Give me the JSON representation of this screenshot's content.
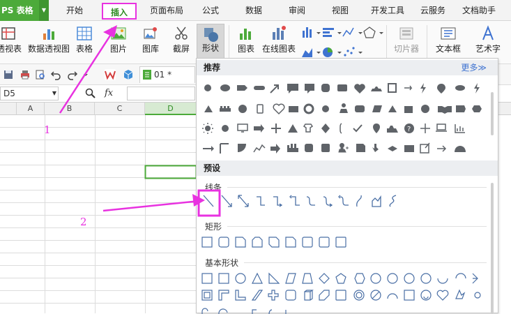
{
  "menubar": {
    "app_name": "PS 表格",
    "items": [
      "开始",
      "插入",
      "页面布局",
      "公式",
      "数据",
      "审阅",
      "视图",
      "开发工具",
      "云服务",
      "文档助手"
    ]
  },
  "ribbon": {
    "buttons": [
      "透视表",
      "数据透视图",
      "表格",
      "图片",
      "图库",
      "截屏",
      "形状",
      "图表",
      "在线图表",
      "切片器",
      "文本框",
      "艺术字"
    ]
  },
  "toolbar": {
    "doc_tab": "01 *"
  },
  "formula_bar": {
    "cell_ref": "D5",
    "fx_label": "fx"
  },
  "sheet": {
    "columns": [
      "A",
      "B",
      "C",
      "D"
    ]
  },
  "shapes_panel": {
    "recommended_header": "推荐",
    "more_link": "更多≫",
    "presets_header": "预设",
    "lines_label": "线条",
    "rect_label": "矩形",
    "basic_label": "基本形状"
  },
  "annotations": {
    "step1": "1",
    "step2": "2"
  },
  "colors": {
    "accent_green": "#4caa3a",
    "highlight_magenta": "#e832e0",
    "link_blue": "#3f73d1",
    "icon_gray": "#5f6368"
  }
}
